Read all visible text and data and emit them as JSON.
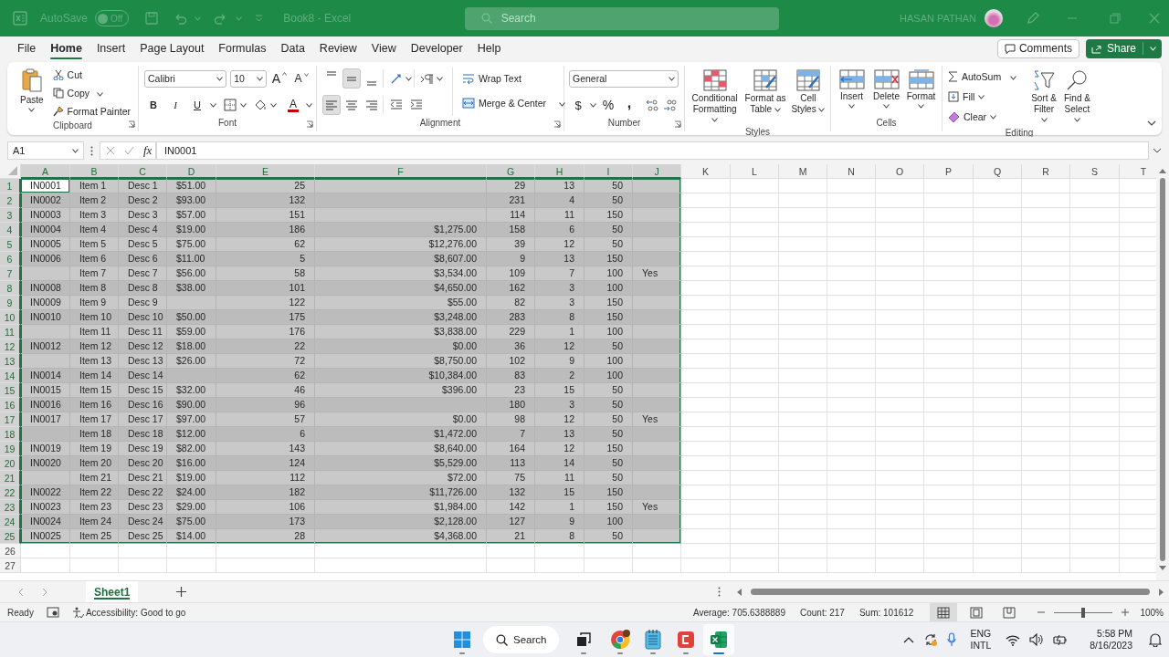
{
  "title_bar": {
    "autosave_label": "AutoSave",
    "autosave_state": "Off",
    "autosave_on": false,
    "title": "Book8 - Excel",
    "search_placeholder": "Search",
    "user": "HASAN PATHAN"
  },
  "menu_tabs": [
    {
      "label": "File",
      "selected": false
    },
    {
      "label": "Home",
      "selected": true
    },
    {
      "label": "Insert",
      "selected": false
    },
    {
      "label": "Page Layout",
      "selected": false
    },
    {
      "label": "Formulas",
      "selected": false
    },
    {
      "label": "Data",
      "selected": false
    },
    {
      "label": "Review",
      "selected": false
    },
    {
      "label": "View",
      "selected": false
    },
    {
      "label": "Developer",
      "selected": false
    },
    {
      "label": "Help",
      "selected": false
    }
  ],
  "comments_button": "Comments",
  "share_button": "Share",
  "ribbon": {
    "clipboard": {
      "label": "Clipboard",
      "paste": "Paste",
      "cut": "Cut",
      "copy": "Copy",
      "format_painter": "Format Painter"
    },
    "font": {
      "label": "Font",
      "name": "Calibri",
      "size": "10",
      "grow": "A",
      "shrink": "A",
      "bold": "B",
      "italic": "I",
      "underline": "U",
      "fg_label": "A"
    },
    "alignment": {
      "label": "Alignment",
      "wrap_text": "Wrap Text",
      "merge": "Merge & Center",
      "vertical": [
        {
          "selected": false
        },
        {
          "selected": true
        },
        {
          "selected": false
        }
      ],
      "horizontal": [
        {
          "selected": true
        },
        {
          "selected": false
        },
        {
          "selected": false
        }
      ]
    },
    "number": {
      "label": "Number",
      "format": "General",
      "currency": "$",
      "percent": "%",
      "comma": ","
    },
    "styles": {
      "label": "Styles",
      "conditional": "Conditional Formatting",
      "format_table": "Format as Table",
      "cell_styles": "Cell Styles"
    },
    "cells": {
      "label": "Cells",
      "insert": "Insert",
      "delete": "Delete",
      "format": "Format"
    },
    "editing": {
      "label": "Editing",
      "autosum": "AutoSum",
      "fill": "Fill",
      "clear": "Clear",
      "sort": "Sort & Filter",
      "find": "Find & Select"
    }
  },
  "formula_bar": {
    "name_box": "A1",
    "function_label": "fx",
    "formula": "IN0001"
  },
  "sheet": {
    "columns": [
      {
        "label": "A",
        "selected": true,
        "active": true
      },
      {
        "label": "B",
        "selected": true,
        "active": false
      },
      {
        "label": "C",
        "selected": true,
        "active": false
      },
      {
        "label": "D",
        "selected": true,
        "active": false
      },
      {
        "label": "E",
        "selected": true,
        "active": false
      },
      {
        "label": "F",
        "selected": true,
        "active": false
      },
      {
        "label": "G",
        "selected": true,
        "active": false
      },
      {
        "label": "H",
        "selected": true,
        "active": false
      },
      {
        "label": "I",
        "selected": true,
        "active": false
      },
      {
        "label": "J",
        "selected": true,
        "active": false
      },
      {
        "label": "K",
        "selected": false,
        "active": false
      },
      {
        "label": "L",
        "selected": false,
        "active": false
      },
      {
        "label": "M",
        "selected": false,
        "active": false
      },
      {
        "label": "N",
        "selected": false,
        "active": false
      },
      {
        "label": "O",
        "selected": false,
        "active": false
      },
      {
        "label": "P",
        "selected": false,
        "active": false
      },
      {
        "label": "Q",
        "selected": false,
        "active": false
      },
      {
        "label": "R",
        "selected": false,
        "active": false
      },
      {
        "label": "S",
        "selected": false,
        "active": false
      },
      {
        "label": "T",
        "selected": false,
        "active": false
      }
    ],
    "rows": [
      {
        "number": "1",
        "selected": true,
        "active": true,
        "cells": [
          "IN0001",
          "Item 1",
          "Desc 1",
          "$51.00",
          "25",
          null,
          "29",
          "13",
          "50",
          null
        ]
      },
      {
        "number": "2",
        "selected": true,
        "active": false,
        "cells": [
          "IN0002",
          "Item 2",
          "Desc 2",
          "$93.00",
          "132",
          null,
          "231",
          "4",
          "50",
          null
        ]
      },
      {
        "number": "3",
        "selected": true,
        "active": false,
        "cells": [
          "IN0003",
          "Item 3",
          "Desc 3",
          "$57.00",
          "151",
          null,
          "114",
          "11",
          "150",
          null
        ]
      },
      {
        "number": "4",
        "selected": true,
        "active": false,
        "cells": [
          "IN0004",
          "Item 4",
          "Desc 4",
          "$19.00",
          "186",
          "$1,275.00",
          "158",
          "6",
          "50",
          null
        ]
      },
      {
        "number": "5",
        "selected": true,
        "active": false,
        "cells": [
          "IN0005",
          "Item 5",
          "Desc 5",
          "$75.00",
          "62",
          "$12,276.00",
          "39",
          "12",
          "50",
          null
        ]
      },
      {
        "number": "6",
        "selected": true,
        "active": false,
        "cells": [
          "IN0006",
          "Item 6",
          "Desc 6",
          "$11.00",
          "5",
          "$8,607.00",
          "9",
          "13",
          "150",
          null
        ]
      },
      {
        "number": "7",
        "selected": true,
        "active": false,
        "cells": [
          null,
          "Item 7",
          "Desc 7",
          "$56.00",
          "58",
          "$3,534.00",
          "109",
          "7",
          "100",
          "Yes"
        ]
      },
      {
        "number": "8",
        "selected": true,
        "active": false,
        "cells": [
          "IN0008",
          "Item 8",
          "Desc 8",
          "$38.00",
          "101",
          "$4,650.00",
          "162",
          "3",
          "100",
          null
        ]
      },
      {
        "number": "9",
        "selected": true,
        "active": false,
        "cells": [
          "IN0009",
          "Item 9",
          "Desc 9",
          null,
          "122",
          "$55.00",
          "82",
          "3",
          "150",
          null
        ]
      },
      {
        "number": "10",
        "selected": true,
        "active": false,
        "cells": [
          "IN0010",
          "Item 10",
          "Desc 10",
          "$50.00",
          "175",
          "$3,248.00",
          "283",
          "8",
          "150",
          null
        ]
      },
      {
        "number": "11",
        "selected": true,
        "active": false,
        "cells": [
          null,
          "Item 11",
          "Desc 11",
          "$59.00",
          "176",
          "$3,838.00",
          "229",
          "1",
          "100",
          null
        ]
      },
      {
        "number": "12",
        "selected": true,
        "active": false,
        "cells": [
          "IN0012",
          "Item 12",
          "Desc 12",
          "$18.00",
          "22",
          "$0.00",
          "36",
          "12",
          "50",
          null
        ]
      },
      {
        "number": "13",
        "selected": true,
        "active": false,
        "cells": [
          null,
          "Item 13",
          "Desc 13",
          "$26.00",
          "72",
          "$8,750.00",
          "102",
          "9",
          "100",
          null
        ]
      },
      {
        "number": "14",
        "selected": true,
        "active": false,
        "cells": [
          "IN0014",
          "Item 14",
          "Desc 14",
          null,
          "62",
          "$10,384.00",
          "83",
          "2",
          "100",
          null
        ]
      },
      {
        "number": "15",
        "selected": true,
        "active": false,
        "cells": [
          "IN0015",
          "Item 15",
          "Desc 15",
          "$32.00",
          "46",
          "$396.00",
          "23",
          "15",
          "50",
          null
        ]
      },
      {
        "number": "16",
        "selected": true,
        "active": false,
        "cells": [
          "IN0016",
          "Item 16",
          "Desc 16",
          "$90.00",
          "96",
          null,
          "180",
          "3",
          "50",
          null
        ]
      },
      {
        "number": "17",
        "selected": true,
        "active": false,
        "cells": [
          "IN0017",
          "Item 17",
          "Desc 17",
          "$97.00",
          "57",
          "$0.00",
          "98",
          "12",
          "50",
          "Yes"
        ]
      },
      {
        "number": "18",
        "selected": true,
        "active": false,
        "cells": [
          null,
          "Item 18",
          "Desc 18",
          "$12.00",
          "6",
          "$1,472.00",
          "7",
          "13",
          "50",
          null
        ]
      },
      {
        "number": "19",
        "selected": true,
        "active": false,
        "cells": [
          "IN0019",
          "Item 19",
          "Desc 19",
          "$82.00",
          "143",
          "$8,640.00",
          "164",
          "12",
          "150",
          null
        ]
      },
      {
        "number": "20",
        "selected": true,
        "active": false,
        "cells": [
          "IN0020",
          "Item 20",
          "Desc 20",
          "$16.00",
          "124",
          "$5,529.00",
          "113",
          "14",
          "50",
          null
        ]
      },
      {
        "number": "21",
        "selected": true,
        "active": false,
        "cells": [
          null,
          "Item 21",
          "Desc 21",
          "$19.00",
          "112",
          "$72.00",
          "75",
          "11",
          "50",
          null
        ]
      },
      {
        "number": "22",
        "selected": true,
        "active": false,
        "cells": [
          "IN0022",
          "Item 22",
          "Desc 22",
          "$24.00",
          "182",
          "$11,726.00",
          "132",
          "15",
          "150",
          null
        ]
      },
      {
        "number": "23",
        "selected": true,
        "active": false,
        "cells": [
          "IN0023",
          "Item 23",
          "Desc 23",
          "$29.00",
          "106",
          "$1,984.00",
          "142",
          "1",
          "150",
          "Yes"
        ]
      },
      {
        "number": "24",
        "selected": true,
        "active": false,
        "cells": [
          "IN0024",
          "Item 24",
          "Desc 24",
          "$75.00",
          "173",
          "$2,128.00",
          "127",
          "9",
          "100",
          null
        ]
      },
      {
        "number": "25",
        "selected": true,
        "active": false,
        "cells": [
          "IN0025",
          "Item 25",
          "Desc 25",
          "$14.00",
          "28",
          "$4,368.00",
          "21",
          "8",
          "50",
          null
        ]
      },
      {
        "number": "26",
        "selected": false,
        "active": false
      },
      {
        "number": "27",
        "selected": false,
        "active": false
      }
    ]
  },
  "sheet_tabs": [
    {
      "label": "Sheet1",
      "selected": true
    }
  ],
  "status_bar": {
    "mode": "Ready",
    "accessibility": "Accessibility: Good to go",
    "average": "Average: 705.6388889",
    "count": "Count: 217",
    "sum": "Sum: 101612",
    "views": [
      {
        "selected": true
      },
      {
        "selected": false
      },
      {
        "selected": false
      }
    ],
    "zoom": {
      "level": 0.5,
      "reading": "100%"
    }
  },
  "taskbar": {
    "search": "Search",
    "language": "ENG",
    "layout": "INTL",
    "time": "5:58 PM",
    "date": "8/16/2023"
  }
}
